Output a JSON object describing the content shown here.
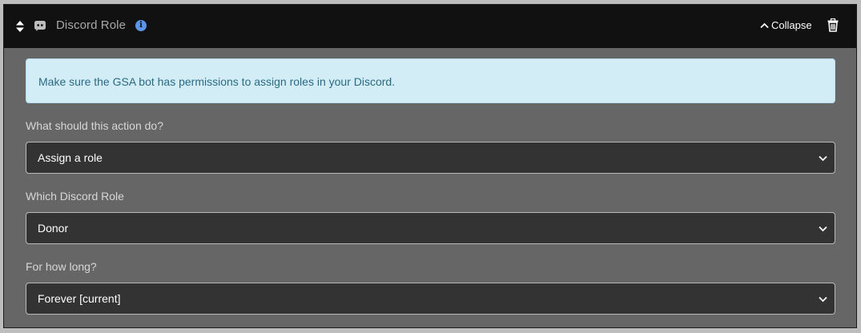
{
  "header": {
    "title": "Discord Role",
    "collapse_label": "Collapse",
    "icons": [
      "sort-handle-icon",
      "discord-icon",
      "info-icon",
      "chevron-up-icon",
      "trash-icon"
    ]
  },
  "alert": {
    "text": "Make sure the GSA bot has permissions to assign roles in your Discord."
  },
  "fields": [
    {
      "label": "What should this action do?",
      "value": "Assign a role"
    },
    {
      "label": "Which Discord Role",
      "value": "Donor"
    },
    {
      "label": "For how long?",
      "value": "Forever [current]"
    }
  ],
  "colors": {
    "header_bg": "#111111",
    "panel_bg": "#666666",
    "alert_bg": "#d3edf7",
    "alert_text": "#2a6a84",
    "select_bg": "#333333",
    "info_icon": "#5b94e8"
  }
}
